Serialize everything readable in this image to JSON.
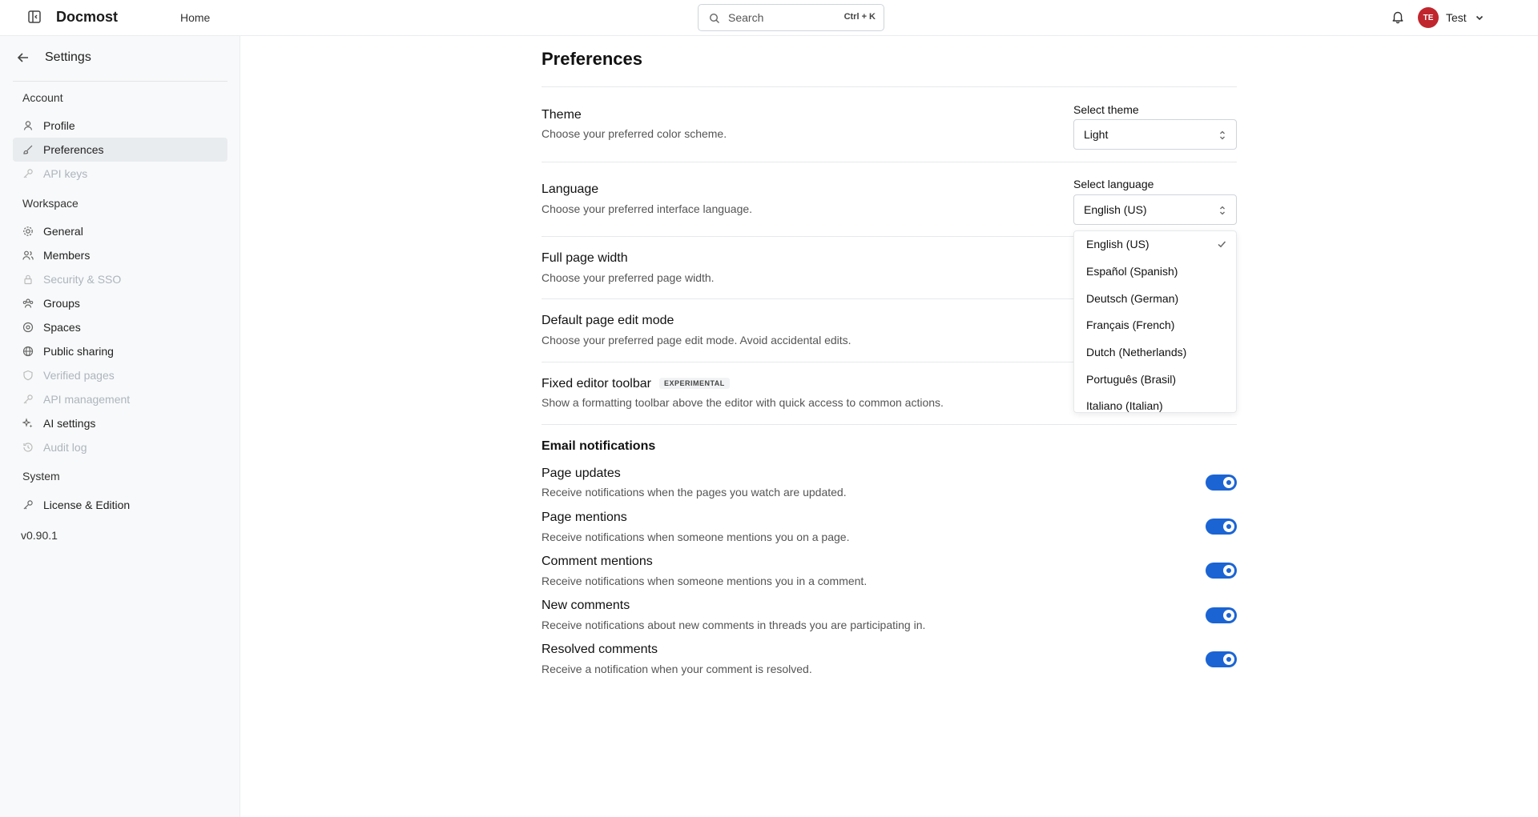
{
  "header": {
    "app_title": "Docmost",
    "home_label": "Home",
    "search": {
      "label": "Search",
      "shortcut": "Ctrl + K"
    },
    "user": {
      "initials": "TE",
      "name": "Test"
    }
  },
  "sidebar": {
    "title": "Settings",
    "groups": {
      "account": "Account",
      "workspace": "Workspace",
      "system": "System"
    },
    "items": {
      "profile": "Profile",
      "preferences": "Preferences",
      "api_keys": "API keys",
      "general": "General",
      "members": "Members",
      "security": "Security & SSO",
      "groups": "Groups",
      "spaces": "Spaces",
      "public_sharing": "Public sharing",
      "verified_pages": "Verified pages",
      "api_management": "API management",
      "ai_settings": "AI settings",
      "audit_log": "Audit log",
      "license": "License & Edition"
    },
    "version": "v0.90.1"
  },
  "main": {
    "page_title": "Preferences",
    "theme": {
      "title": "Theme",
      "desc": "Choose your preferred color scheme.",
      "field_label": "Select theme",
      "value": "Light"
    },
    "language": {
      "title": "Language",
      "desc": "Choose your preferred interface language.",
      "field_label": "Select language",
      "value": "English (US)",
      "options": [
        "English (US)",
        "Español (Spanish)",
        "Deutsch (German)",
        "Français (French)",
        "Dutch (Netherlands)",
        "Português (Brasil)",
        "Italiano (Italian)"
      ],
      "selected_index": 0
    },
    "full_width": {
      "title": "Full page width",
      "desc": "Choose your preferred page width."
    },
    "edit_mode": {
      "title": "Default page edit mode",
      "desc": "Choose your preferred page edit mode. Avoid accidental edits."
    },
    "toolbar": {
      "title": "Fixed editor toolbar",
      "badge": "EXPERIMENTAL",
      "desc": "Show a formatting toolbar above the editor with quick access to common actions."
    },
    "email": {
      "section_title": "Email notifications",
      "items": [
        {
          "title": "Page updates",
          "desc": "Receive notifications when the pages you watch are updated.",
          "enabled": true
        },
        {
          "title": "Page mentions",
          "desc": "Receive notifications when someone mentions you on a page.",
          "enabled": true
        },
        {
          "title": "Comment mentions",
          "desc": "Receive notifications when someone mentions you in a comment.",
          "enabled": true
        },
        {
          "title": "New comments",
          "desc": "Receive notifications about new comments in threads you are participating in.",
          "enabled": true
        },
        {
          "title": "Resolved comments",
          "desc": "Receive a notification when your comment is resolved.",
          "enabled": true
        }
      ]
    }
  },
  "colors": {
    "accent": "#1b64d4",
    "avatar_bg": "#c0262d",
    "sidebar_bg": "#f8f9fa",
    "disabled_text": "#adb5bd"
  }
}
